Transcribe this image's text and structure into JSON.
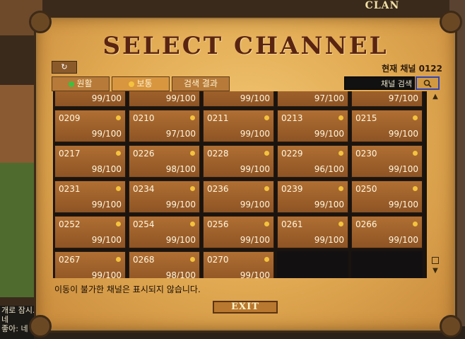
{
  "background": {
    "clan_label": "CLAN",
    "chat_lines": [
      "개로 잠시..",
      "네",
      "좋아: 네"
    ]
  },
  "dialog": {
    "title": "SELECT CHANNEL",
    "refresh_symbol": "↻",
    "tabs": [
      {
        "label": "원활",
        "dot_color": "#3fbf3f",
        "active": false
      },
      {
        "label": "보통",
        "dot_color": "#f4c23e",
        "active": true
      },
      {
        "label": "검색 결과",
        "active": false
      }
    ],
    "current_channel_label": "현재 채널",
    "current_channel_value": "0122",
    "search": {
      "placeholder": "채널 검색",
      "button_icon": "magnifier-icon"
    },
    "partial_row": [
      "99/100",
      "99/100",
      "99/100",
      "97/100",
      "97/100"
    ],
    "channels": [
      {
        "id": "0209",
        "cap": "99/100"
      },
      {
        "id": "0210",
        "cap": "97/100"
      },
      {
        "id": "0211",
        "cap": "99/100"
      },
      {
        "id": "0213",
        "cap": "99/100"
      },
      {
        "id": "0215",
        "cap": "99/100"
      },
      {
        "id": "0217",
        "cap": "98/100"
      },
      {
        "id": "0226",
        "cap": "98/100"
      },
      {
        "id": "0228",
        "cap": "99/100"
      },
      {
        "id": "0229",
        "cap": "96/100"
      },
      {
        "id": "0230",
        "cap": "99/100"
      },
      {
        "id": "0231",
        "cap": "99/100"
      },
      {
        "id": "0234",
        "cap": "99/100"
      },
      {
        "id": "0236",
        "cap": "99/100"
      },
      {
        "id": "0239",
        "cap": "99/100"
      },
      {
        "id": "0250",
        "cap": "99/100"
      },
      {
        "id": "0252",
        "cap": "99/100"
      },
      {
        "id": "0254",
        "cap": "99/100"
      },
      {
        "id": "0256",
        "cap": "99/100"
      },
      {
        "id": "0261",
        "cap": "99/100"
      },
      {
        "id": "0266",
        "cap": "99/100"
      },
      {
        "id": "0267",
        "cap": "99/100"
      },
      {
        "id": "0268",
        "cap": "98/100"
      },
      {
        "id": "0270",
        "cap": "99/100"
      }
    ],
    "status_dot_color": "#f4c23e",
    "notice": "이동이 불가한 채널은 표시되지 않습니다.",
    "exit_label": "EXIT"
  }
}
